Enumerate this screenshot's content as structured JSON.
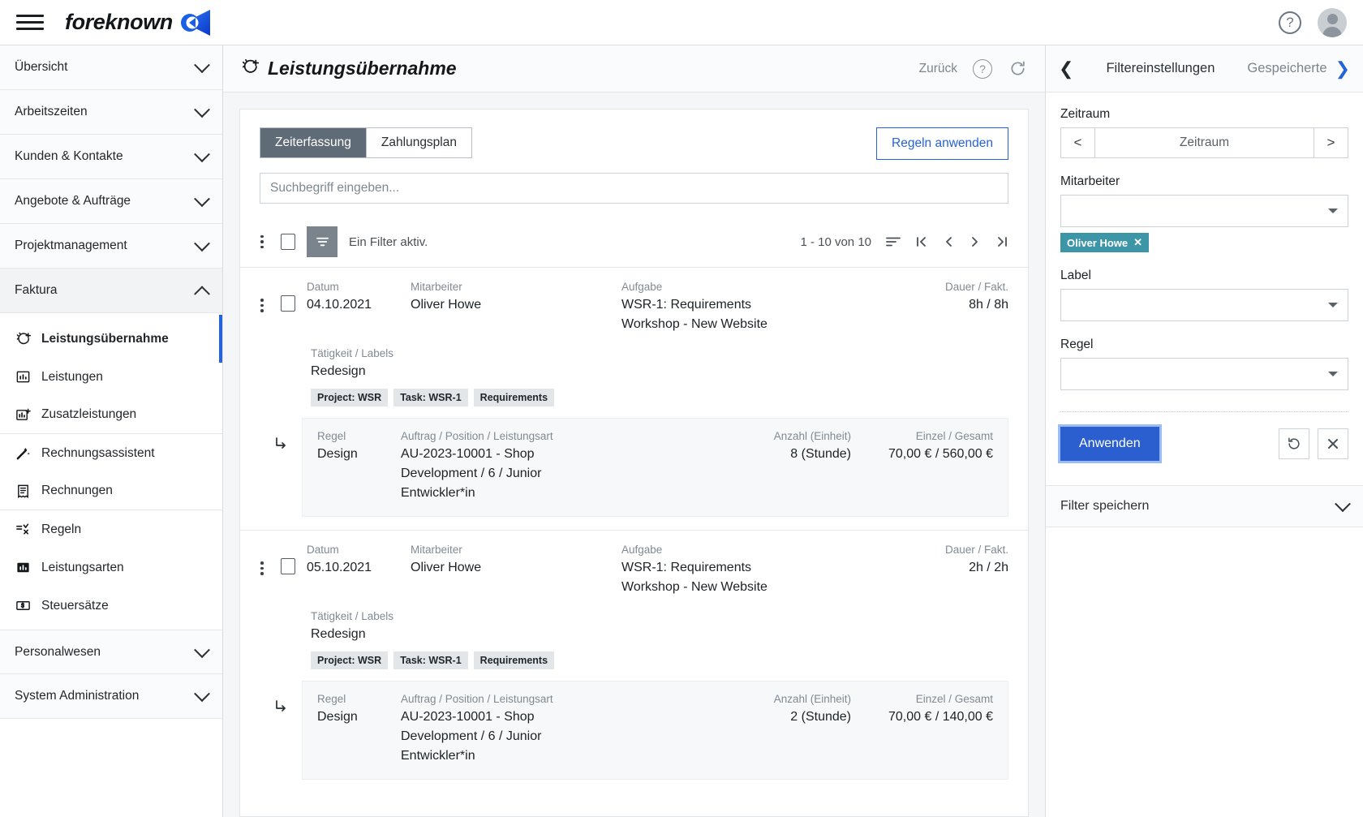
{
  "topbar": {
    "brand": "foreknown",
    "menu_icon": "hamburger-icon",
    "help_icon": "?",
    "avatar_icon": "user-avatar"
  },
  "sidebar": {
    "groups": [
      {
        "label": "Übersicht",
        "state": "collapsed"
      },
      {
        "label": "Arbeitszeiten",
        "state": "collapsed"
      },
      {
        "label": "Kunden & Kontakte",
        "state": "collapsed"
      },
      {
        "label": "Angebote & Aufträge",
        "state": "collapsed"
      },
      {
        "label": "Projektmanagement",
        "state": "collapsed"
      },
      {
        "label": "Faktura",
        "state": "expanded"
      }
    ],
    "faktura_items": [
      {
        "label": "Leistungsübernahme",
        "icon": "magic-transfer-icon",
        "active": true
      },
      {
        "label": "Leistungen",
        "icon": "chart-bar-icon",
        "active": false
      },
      {
        "label": "Zusatzleistungen",
        "icon": "chart-bar-plus-icon",
        "active": false
      },
      {
        "label": "Rechnungsassistent",
        "icon": "magic-wand-icon",
        "active": false
      },
      {
        "label": "Rechnungen",
        "icon": "invoice-icon",
        "active": false
      },
      {
        "label": "Regeln",
        "icon": "rules-icon",
        "active": false
      },
      {
        "label": "Leistungsarten",
        "icon": "chart-bar-filled-icon",
        "active": false
      },
      {
        "label": "Steuersätze",
        "icon": "money-icon",
        "active": false
      }
    ],
    "bottom_groups": [
      {
        "label": "Personalwesen",
        "state": "collapsed"
      },
      {
        "label": "System Administration",
        "state": "collapsed"
      }
    ]
  },
  "page": {
    "title": "Leistungsübernahme",
    "title_icon": "magic-transfer-icon",
    "back_label": "Zurück",
    "help_icon": "help-circle-icon",
    "refresh_icon": "refresh-icon"
  },
  "toolbar": {
    "tabs": [
      {
        "label": "Zeiterfassung",
        "active": true
      },
      {
        "label": "Zahlungsplan",
        "active": false
      }
    ],
    "apply_rules_label": "Regeln anwenden",
    "search_placeholder": "Suchbegriff eingeben...",
    "search_value": "",
    "filter_status": "Ein Filter aktiv.",
    "pagination": "1 - 10 von 10",
    "sort_icon": "sort-icon",
    "first_icon": "|<",
    "prev_icon": "<",
    "next_icon": ">",
    "last_icon": ">|"
  },
  "table": {
    "headers": {
      "datum": "Datum",
      "mitarbeiter": "Mitarbeiter",
      "aufgabe": "Aufgabe",
      "dauer": "Dauer / Fakt.",
      "taetigkeit": "Tätigkeit / Labels",
      "regel": "Regel",
      "auftrag": "Auftrag / Position / Leistungsart",
      "anzahl": "Anzahl (Einheit)",
      "einzel": "Einzel / Gesamt"
    },
    "rows": [
      {
        "datum": "04.10.2021",
        "mitarbeiter": "Oliver Howe",
        "aufgabe": "WSR-1: Requirements Workshop - New Website",
        "dauer": "8h / 8h",
        "taetigkeit": "Redesign",
        "labels": [
          "Project: WSR",
          "Task: WSR-1",
          "Requirements"
        ],
        "sub": {
          "regel": "Design",
          "auftrag": "AU-2023-10001 - Shop Development / 6 / Junior Entwickler*in",
          "anzahl": "8 (Stunde)",
          "einzel": "70,00 € / 560,00 €"
        }
      },
      {
        "datum": "05.10.2021",
        "mitarbeiter": "Oliver Howe",
        "aufgabe": "WSR-1: Requirements Workshop - New Website",
        "dauer": "2h / 2h",
        "taetigkeit": "Redesign",
        "labels": [
          "Project: WSR",
          "Task: WSR-1",
          "Requirements"
        ],
        "sub": {
          "regel": "Design",
          "auftrag": "AU-2023-10001 - Shop Development / 6 / Junior Entwickler*in",
          "anzahl": "2 (Stunde)",
          "einzel": "70,00 € / 140,00 €"
        }
      }
    ]
  },
  "filter_panel": {
    "back_icon": "chevron-left-icon",
    "title": "Filtereinstellungen",
    "saved_tab": "Gespeicherte",
    "forward_icon": "chevron-right-icon",
    "zeitraum_label": "Zeitraum",
    "zeitraum_value": "Zeitraum",
    "zeitraum_prev": "<",
    "zeitraum_next": ">",
    "mitarbeiter_label": "Mitarbeiter",
    "mitarbeiter_value": "",
    "mitarbeiter_chip": "Oliver Howe",
    "mitarbeiter_chip_remove": "✕",
    "label_label": "Label",
    "label_value": "",
    "regel_label": "Regel",
    "regel_value": "",
    "apply_label": "Anwenden",
    "reset_icon": "undo-icon",
    "clear_icon": "close-icon",
    "save_filter_label": "Filter speichern"
  },
  "colors": {
    "accent_blue": "#2563d9",
    "tab_active_bg": "#5f6b76",
    "chip_teal": "#3d96a8",
    "apply_btn": "#2b5fd0"
  }
}
